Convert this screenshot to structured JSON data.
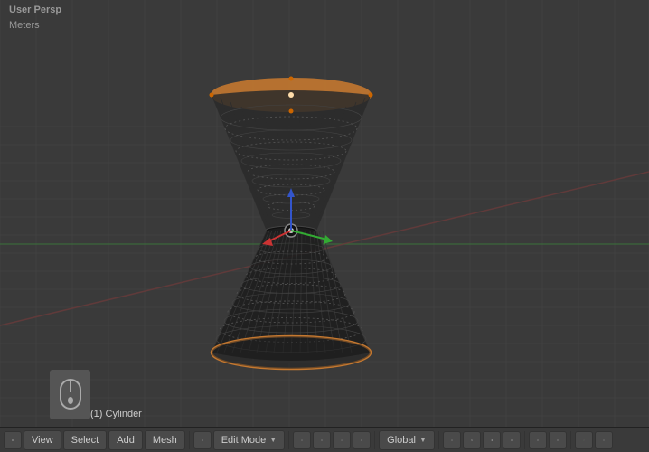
{
  "viewport": {
    "perspective_label": "User Persp",
    "units_label": "Meters",
    "object_name": "(1) Cylinder"
  },
  "toolbar": {
    "items": [
      {
        "id": "view-icon",
        "type": "icon",
        "label": ""
      },
      {
        "id": "view",
        "label": "View"
      },
      {
        "id": "select",
        "label": "Select"
      },
      {
        "id": "add",
        "label": "Add"
      },
      {
        "id": "mesh",
        "label": "Mesh"
      },
      {
        "id": "mode-icon",
        "type": "icon",
        "label": ""
      },
      {
        "id": "edit-mode",
        "label": "Edit Mode",
        "dropdown": true
      },
      {
        "id": "pivot-icon",
        "type": "icon",
        "label": "●"
      },
      {
        "id": "snap-icon",
        "type": "icon",
        "label": ""
      },
      {
        "id": "transform-icon",
        "type": "icon",
        "label": ""
      },
      {
        "id": "global",
        "label": "Global",
        "dropdown": true
      },
      {
        "id": "right-icons",
        "label": ""
      }
    ],
    "select_label": "Select",
    "view_label": "View",
    "add_label": "Add",
    "mesh_label": "Mesh",
    "edit_mode_label": "Edit Mode",
    "global_label": "Global"
  },
  "colors": {
    "background": "#3a3a3a",
    "grid_line": "#444",
    "grid_center_x": "#4a6a4a",
    "grid_center_y": "#6a4a4a",
    "object_fill": "#2a2a2a",
    "object_selected_top": "#c87030",
    "object_selected_bottom": "#c87030",
    "axis_x": "#cc2222",
    "axis_y": "#22aa22",
    "axis_z": "#2222cc",
    "toolbar_bg": "#3a3a3a"
  }
}
